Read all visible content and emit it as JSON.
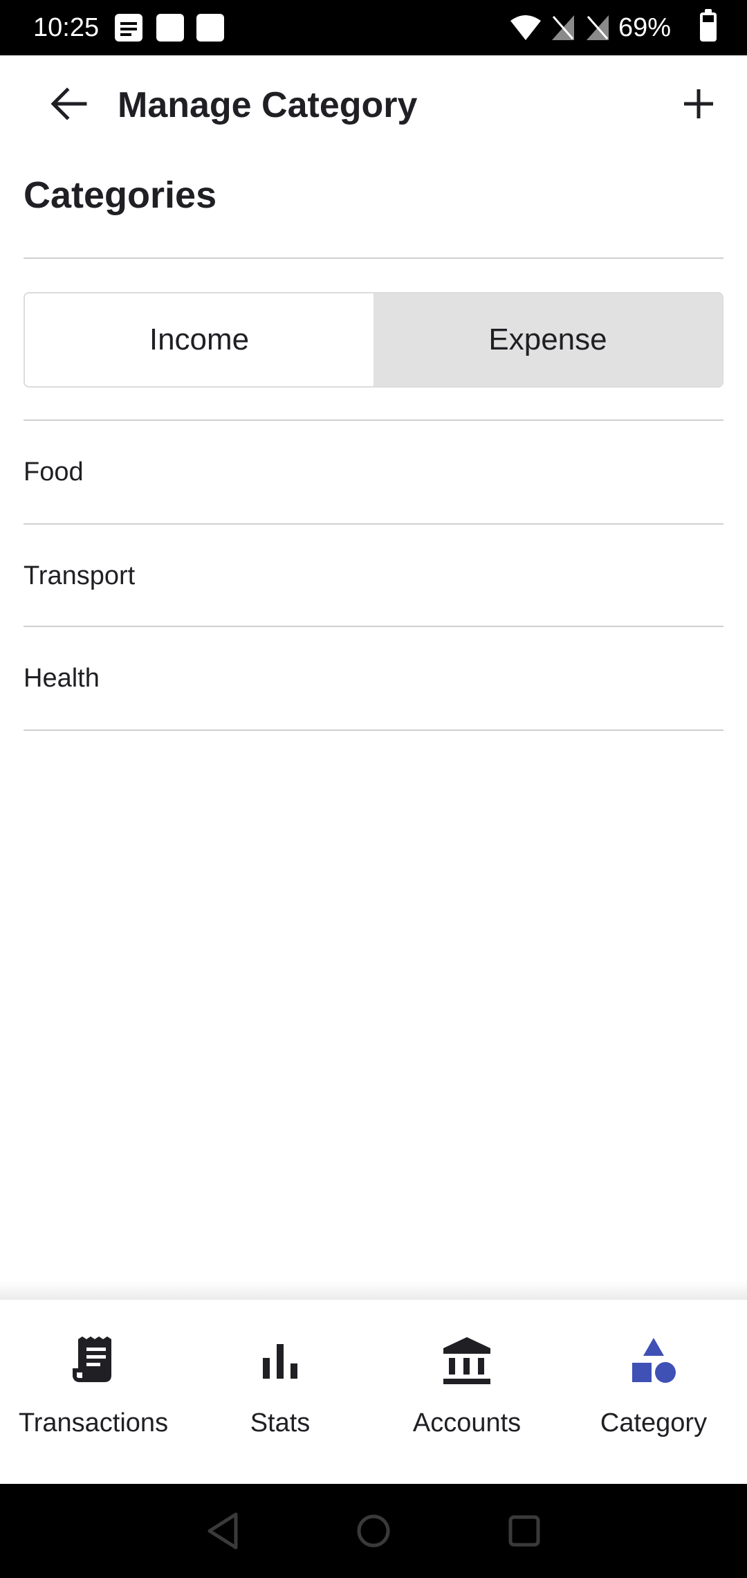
{
  "status_bar": {
    "time": "10:25",
    "battery": "69%"
  },
  "app_bar": {
    "title": "Manage Category"
  },
  "section": {
    "title": "Categories"
  },
  "segments": [
    {
      "label": "Income",
      "selected": false
    },
    {
      "label": "Expense",
      "selected": true
    }
  ],
  "categories": [
    {
      "label": "Food"
    },
    {
      "label": "Transport"
    },
    {
      "label": "Health"
    }
  ],
  "bottom_nav": [
    {
      "label": "Transactions",
      "icon": "receipt-icon",
      "active": false
    },
    {
      "label": "Stats",
      "icon": "bar-chart-icon",
      "active": false
    },
    {
      "label": "Accounts",
      "icon": "bank-icon",
      "active": false
    },
    {
      "label": "Category",
      "icon": "category-shapes-icon",
      "active": true
    }
  ],
  "colors": {
    "accent": "#3f51b5",
    "text": "#1f1f24",
    "selected_segment": "#e1e1e1",
    "divider": "#cfcfd2"
  }
}
